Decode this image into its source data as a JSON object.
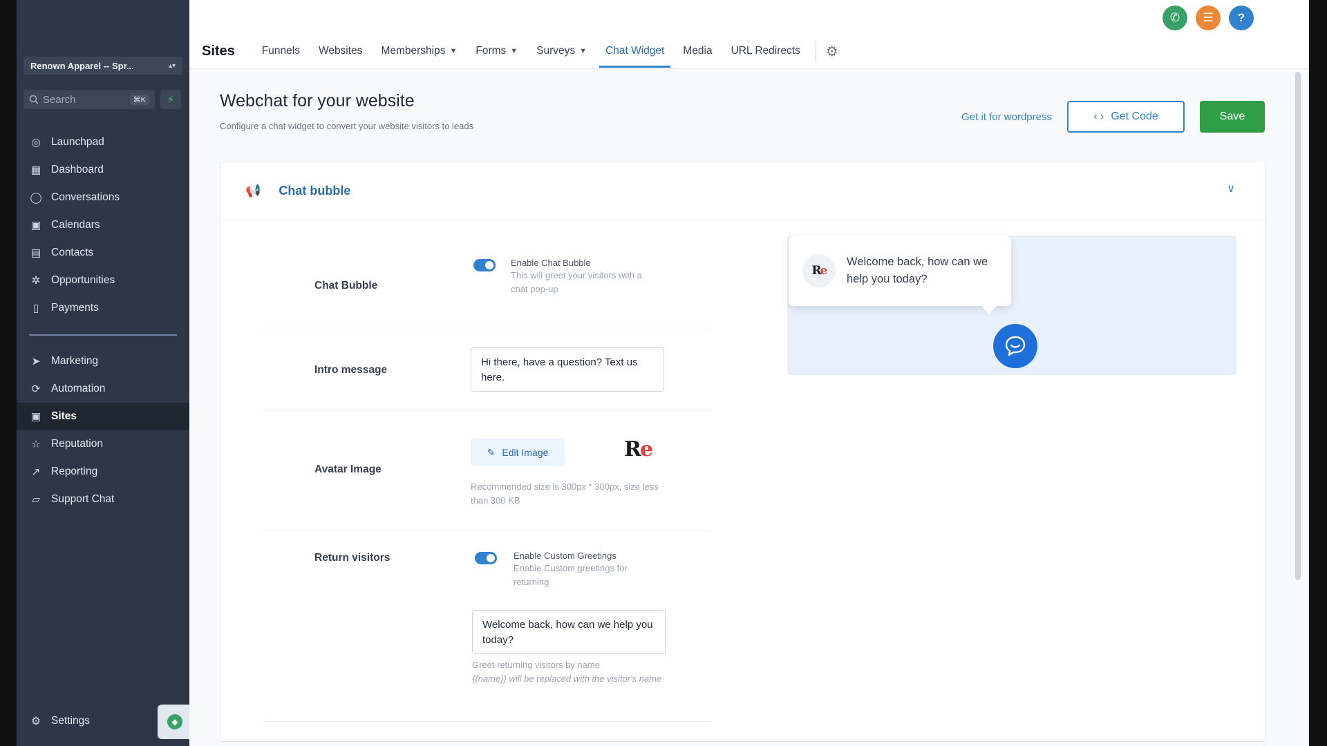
{
  "sidebar": {
    "account_name": "Renown Apparel -- Spr...",
    "search_placeholder": "Search",
    "search_shortcut": "⌘K",
    "items": [
      {
        "label": "Launchpad"
      },
      {
        "label": "Dashboard"
      },
      {
        "label": "Conversations"
      },
      {
        "label": "Calendars"
      },
      {
        "label": "Contacts"
      },
      {
        "label": "Opportunities"
      },
      {
        "label": "Payments"
      },
      {
        "label": "Marketing"
      },
      {
        "label": "Automation"
      },
      {
        "label": "Sites"
      },
      {
        "label": "Reputation"
      },
      {
        "label": "Reporting"
      },
      {
        "label": "Support Chat"
      }
    ],
    "settings_label": "Settings"
  },
  "header": {
    "section_title": "Sites",
    "tabs": [
      {
        "label": "Funnels"
      },
      {
        "label": "Websites"
      },
      {
        "label": "Memberships"
      },
      {
        "label": "Forms"
      },
      {
        "label": "Surveys"
      },
      {
        "label": "Chat Widget"
      },
      {
        "label": "Media"
      },
      {
        "label": "URL Redirects"
      }
    ],
    "help_label": "?"
  },
  "page": {
    "title": "Webchat for your website",
    "subtitle": "Configure a chat widget to convert your website visitors to leads",
    "wordpress_link": "Get it for wordpress",
    "get_code_label": "Get Code",
    "save_label": "Save"
  },
  "card": {
    "title": "Chat bubble",
    "chat_bubble": {
      "label": "Chat Bubble",
      "option_title": "Enable Chat Bubble",
      "option_desc": "This will greet your visitors with a chat pop-up",
      "enabled": true
    },
    "intro": {
      "label": "Intro message",
      "value": "Hi there, have a question? Text us here."
    },
    "avatar": {
      "label": "Avatar Image",
      "edit_label": "Edit Image",
      "hint": "Recommended size is 300px * 300px, size less than 300 KB"
    },
    "return_visitors": {
      "label": "Return visitors",
      "option_title": "Enable Custom Greetings",
      "option_desc": "Enable Custom greetings for returning",
      "enabled": true,
      "value": "Welcome back, how can we help you today?",
      "hint_line1": "Greet returning visitors by name",
      "hint_token": "{{name}}",
      "hint_rest": " will be replaced with the visitor's name"
    }
  },
  "preview": {
    "message": "Welcome back, how can we help you today?"
  },
  "colors": {
    "sidebar_bg": "#2d3748",
    "accent": "#3182ce",
    "save_green": "#2f9e44",
    "phone_green": "#38a169",
    "menu_orange": "#ed8936",
    "help_blue": "#3182ce"
  }
}
